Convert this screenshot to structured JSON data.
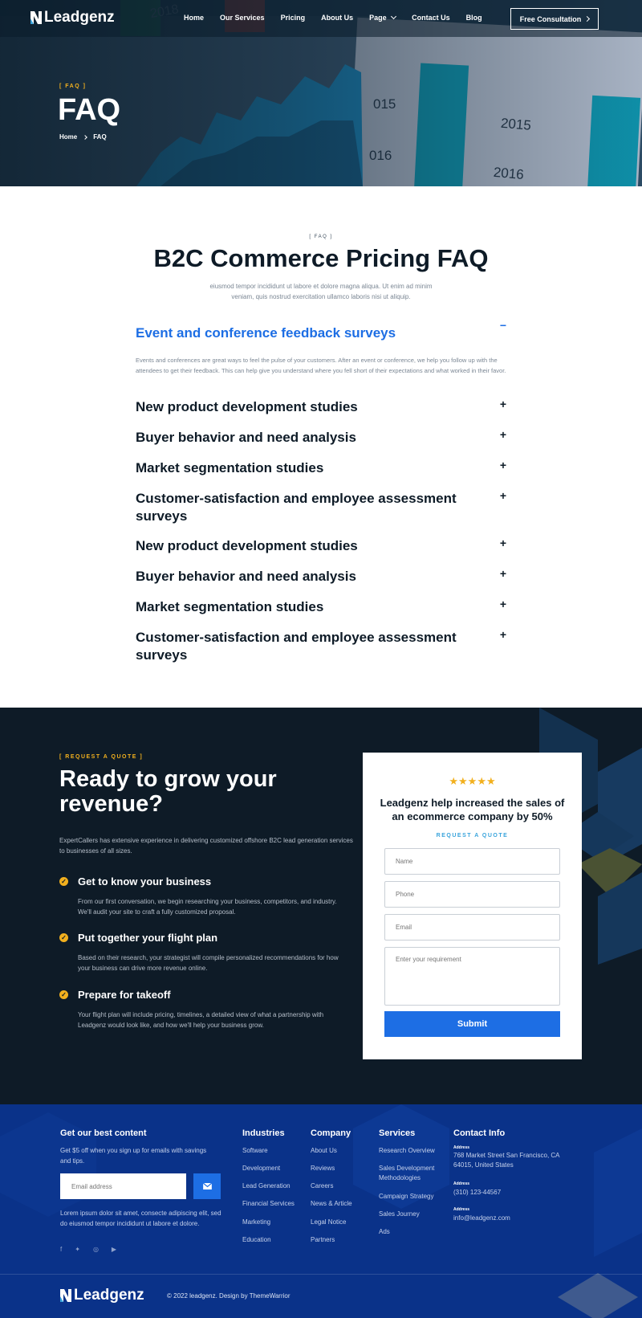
{
  "brand": {
    "name": "Leadgenz",
    "accent": "#1d6ee4",
    "gold": "#f2b01e",
    "dark": "#0e1b27",
    "footer_bg": "#0a3289"
  },
  "nav": {
    "items": [
      "Home",
      "Our Services",
      "Pricing",
      "About Us",
      "Page",
      "Contact Us",
      "Blog"
    ],
    "cta": "Free Consultation"
  },
  "hero": {
    "eyebrow": "[ FAQ ]",
    "title": "FAQ",
    "breadcrumb": [
      "Home",
      "FAQ"
    ],
    "background_labels": [
      "2018",
      "2015",
      "2016",
      "015",
      "016",
      "2015",
      "2016"
    ]
  },
  "faq": {
    "eyebrow": "[ FAQ ]",
    "title": "B2C Commerce Pricing FAQ",
    "description": "eiusmod tempor incididunt ut labore et dolore magna aliqua. Ut enim ad minim veniam, quis nostrud exercitation ullamco laboris nisi ut aliquip.",
    "items": [
      {
        "question": "Event and conference feedback surveys",
        "toggle": "−"
      },
      {
        "question": "New product development studies",
        "toggle": "+"
      },
      {
        "question": "Buyer behavior and need analysis",
        "toggle": "+"
      },
      {
        "question": "Market segmentation studies",
        "toggle": "+"
      },
      {
        "question": "Customer-satisfaction and employee assessment surveys",
        "toggle": "+"
      },
      {
        "question": "New product development studies",
        "toggle": "+"
      },
      {
        "question": "Buyer behavior and need analysis",
        "toggle": "+"
      },
      {
        "question": "Market segmentation studies",
        "toggle": "+"
      },
      {
        "question": "Customer-satisfaction and employee assessment surveys",
        "toggle": "+"
      }
    ],
    "open_answer": "Events and conferences are great ways to feel the pulse of your customers. After an event or conference, we help you follow up with the attendees to get their feedback. This can help give you understand where you fell short of their expectations and what worked in their favor."
  },
  "quote": {
    "eyebrow": "[ REQUEST A QUOTE ]",
    "title": "Ready to grow your revenue?",
    "text": "ExpertCallers has extensive experience in delivering customized offshore B2C lead generation services to businesses of all sizes.",
    "steps": [
      {
        "title": "Get to know your business",
        "text": "From our first conversation, we begin researching your business, competitors, and industry. We'll audit your site to craft a fully customized proposal."
      },
      {
        "title": "Put together your flight plan",
        "text": "Based on their research, your strategist will compile personalized recommendations for how your business can drive more revenue online."
      },
      {
        "title": "Prepare for takeoff",
        "text": "Your flight plan will include pricing, timelines, a detailed view of what a partnership with Leadgenz would look like, and how we'll help your business grow."
      }
    ],
    "card": {
      "stars": "★★★★★",
      "rating": 5,
      "title": "Leadgenz help increased the sales of an ecommerce company by 50%",
      "eyebrow": "REQUEST A QUOTE",
      "placeholders": {
        "name": "Name",
        "phone": "Phone",
        "email": "Email",
        "requirement": "Enter your requirement"
      },
      "submit": "Submit"
    }
  },
  "footer": {
    "newsletter": {
      "title": "Get our best content",
      "text": "Get $5 off when you sign up for emails with savings and tips.",
      "placeholder": "Email address",
      "about": "Lorem ipsum dolor sit amet, consecte adipiscing elit, sed do eiusmod tempor incididunt ut labore et dolore."
    },
    "industries": {
      "title": "Industries",
      "links": [
        "Software",
        "Development",
        "Lead Generation",
        "Financial Services",
        "Marketing",
        "Education"
      ]
    },
    "company": {
      "title": "Company",
      "links": [
        "About Us",
        "Reviews",
        "Careers",
        "News & Article",
        "Legal Notice",
        "Partners"
      ]
    },
    "services": {
      "title": "Services",
      "links": [
        "Research Overview",
        "Sales Development Methodologies",
        "Campaign Strategy",
        "Sales Journey",
        "Ads"
      ]
    },
    "contact": {
      "title": "Contact Info",
      "entries": [
        {
          "label": "Address",
          "value": "768 Market Street San Francisco, CA 64015, United States"
        },
        {
          "label": "Address",
          "value": "(310) 123-44567"
        },
        {
          "label": "Address",
          "value": "info@leadgenz.com"
        }
      ]
    },
    "social_icons": [
      "facebook-icon",
      "twitter-icon",
      "instagram-icon",
      "youtube-icon"
    ],
    "copyright": "© 2022 leadgenz. Design by ThemeWarrior"
  }
}
